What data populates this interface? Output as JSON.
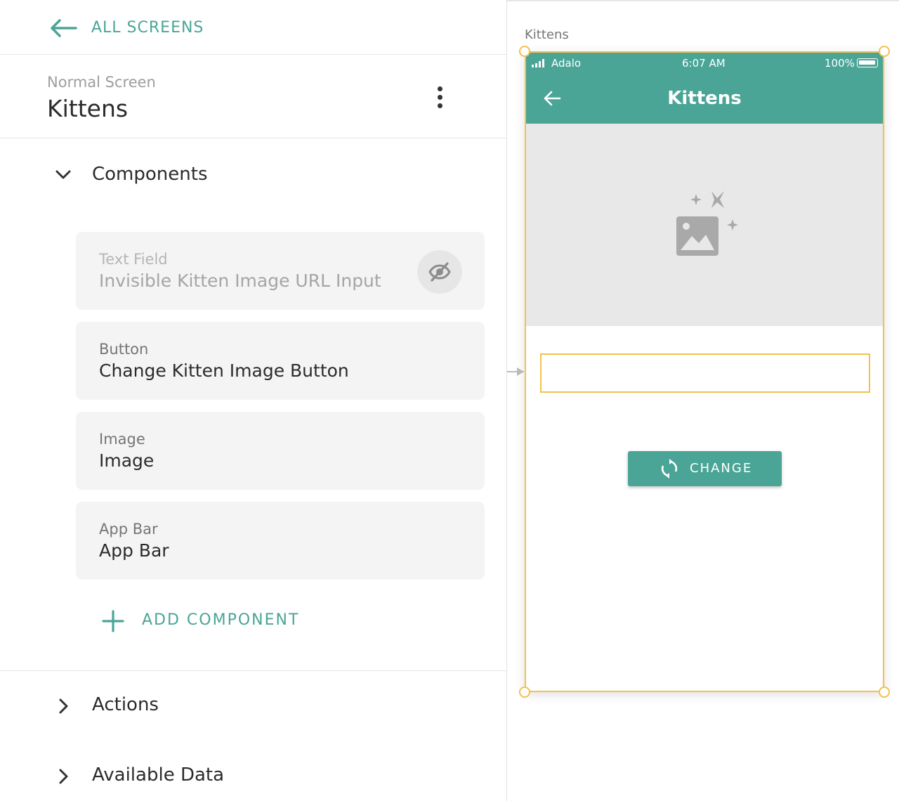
{
  "nav": {
    "back_label": "ALL SCREENS"
  },
  "screen": {
    "type": "Normal Screen",
    "name": "Kittens"
  },
  "sections": {
    "components": "Components",
    "actions": "Actions",
    "available_data": "Available Data"
  },
  "components": [
    {
      "type": "Text Field",
      "name": "Invisible Kitten Image URL Input",
      "visible": false
    },
    {
      "type": "Button",
      "name": "Change Kitten Image Button",
      "visible": true
    },
    {
      "type": "Image",
      "name": "Image",
      "visible": true
    },
    {
      "type": "App Bar",
      "name": "App Bar",
      "visible": true
    }
  ],
  "add_component_label": "ADD COMPONENT",
  "canvas": {
    "screen_label": "Kittens",
    "status": {
      "carrier": "Adalo",
      "time": "6:07 AM",
      "battery": "100%"
    },
    "appbar_title": "Kittens",
    "button_label": "CHANGE"
  },
  "colors": {
    "accent": "#4aa597",
    "selection": "#f2c14e",
    "image_bg": "#e8e8e8"
  }
}
